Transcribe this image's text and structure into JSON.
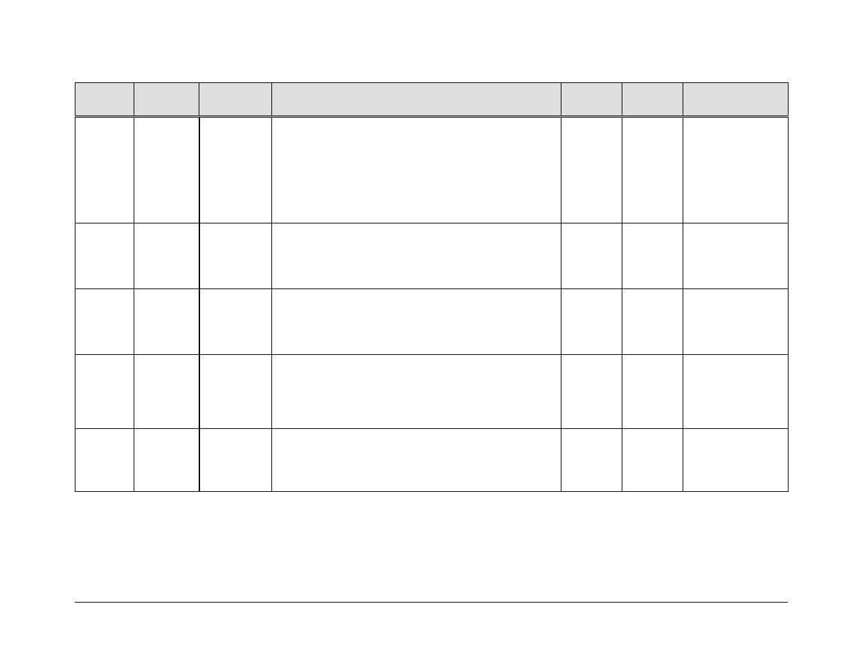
{
  "table": {
    "headers": [
      "",
      "",
      "",
      "",
      "",
      "",
      ""
    ],
    "rows": [
      [
        "",
        "",
        "",
        "",
        "",
        "",
        ""
      ],
      [
        "",
        "",
        "",
        "",
        "",
        "",
        ""
      ],
      [
        "",
        "",
        "",
        "",
        "",
        "",
        ""
      ],
      [
        "",
        "",
        "",
        "",
        "",
        "",
        ""
      ],
      [
        "",
        "",
        "",
        "",
        "",
        "",
        ""
      ]
    ]
  }
}
